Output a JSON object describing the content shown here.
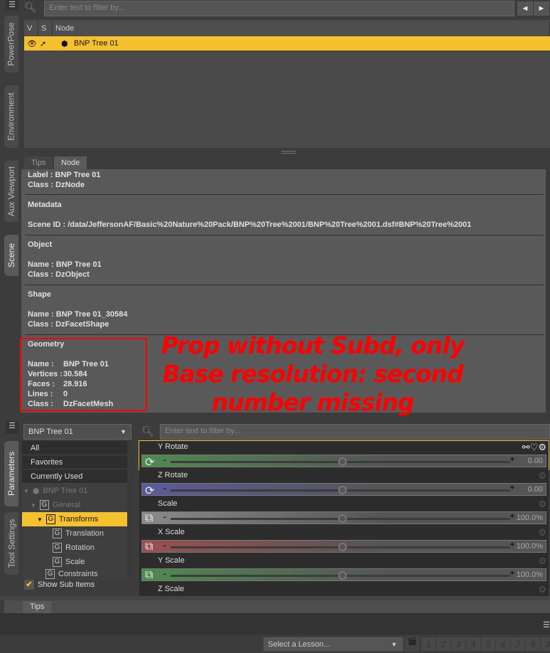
{
  "side_tabs_top": [
    "PowerPose",
    "Environment",
    "Aux Viewport",
    "Scene"
  ],
  "side_tabs_bottom": [
    "Parameters",
    "Tool Settings"
  ],
  "scene": {
    "filter_placeholder": "Enter text to filter by...",
    "columns": [
      "V",
      "S",
      "Node"
    ],
    "rows": [
      {
        "name": "BNP Tree 01",
        "selected": true
      }
    ]
  },
  "info_tabs": [
    "Tips",
    "Node"
  ],
  "info": {
    "label": "Label : BNP Tree 01",
    "class1": "Class : DzNode",
    "metadata": "Metadata",
    "scene_id": "Scene ID : /data/JeffersonAF/Basic%20Nature%20Pack/BNP%20Tree%2001/BNP%20Tree%2001.dsf#BNP%20Tree%2001",
    "object": "Object",
    "obj_name": "Name : BNP Tree 01",
    "obj_class": "Class : DzObject",
    "shape": "Shape",
    "shape_name": "Name : BNP Tree 01_30584",
    "shape_class": "Class : DzFacetShape",
    "geometry": "Geometry",
    "geo": [
      [
        "Name :",
        "BNP Tree 01"
      ],
      [
        "Vertices :",
        "30.584"
      ],
      [
        "Faces :",
        "28.916"
      ],
      [
        "Lines :",
        "0"
      ],
      [
        "Class :",
        "DzFacetMesh"
      ]
    ]
  },
  "annotation": {
    "text_line1": "Prop without Subd, only",
    "text_line2": "Base resolution: second",
    "text_line3": "number missing",
    "color": "#ff0000"
  },
  "params": {
    "node_select": "BNP Tree 01",
    "filter_placeholder": "Enter text to filter by...",
    "lists": [
      "All",
      "Favorites",
      "Currently Used"
    ],
    "tree": [
      "BNP Tree 01",
      "General",
      "Transforms",
      "Translation",
      "Rotation",
      "Scale",
      "Constraints"
    ],
    "show_sub_items": "Show Sub Items",
    "show_sub_items_checked": true,
    "sliders": [
      {
        "label": "Y Rotate",
        "value": "0.00",
        "color": "#4f8a4f"
      },
      {
        "label": "Z Rotate",
        "value": "0.00",
        "color": "#5a5a9a"
      },
      {
        "label": "Scale",
        "value": "100.0%",
        "color": "#8a8a8a"
      },
      {
        "label": "X Scale",
        "value": "100.0%",
        "color": "#9a5050"
      },
      {
        "label": "Y Scale",
        "value": "100.0%",
        "color": "#4f8a4f"
      },
      {
        "label": "Z Scale",
        "value": "",
        "color": "#5a5a9a"
      }
    ]
  },
  "bottom": {
    "tab": "Tips",
    "lesson": "Select a Lesson...",
    "pages": [
      "1",
      "2",
      "3",
      "4",
      "5",
      "6",
      "7",
      "8",
      "9"
    ]
  },
  "accent": "#f5c12d"
}
